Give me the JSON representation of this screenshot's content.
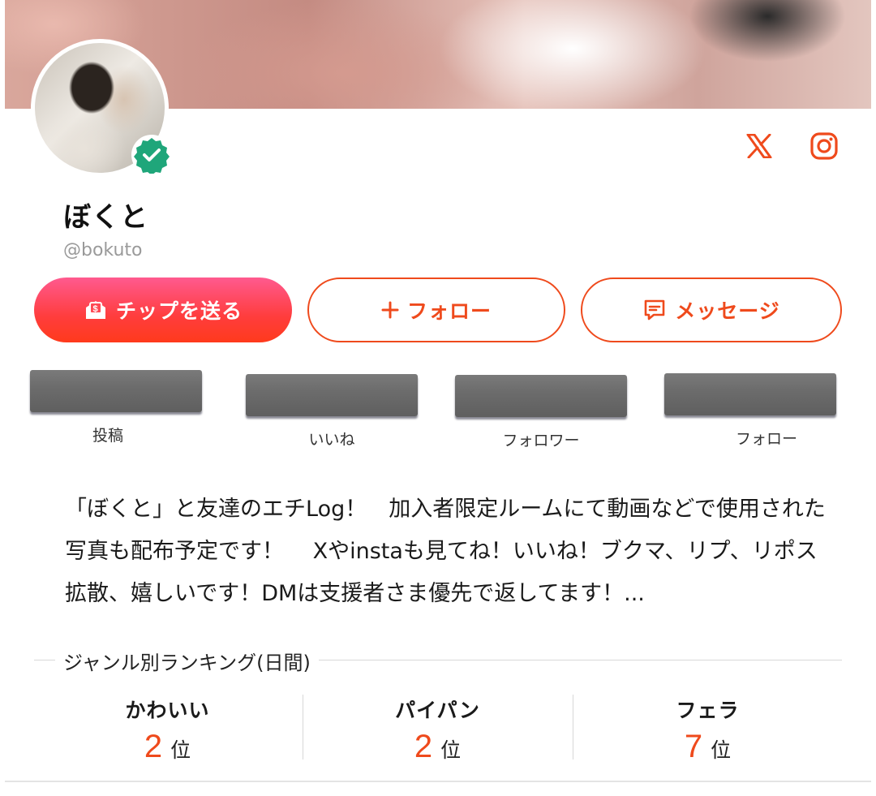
{
  "profile": {
    "name": "ぼくと",
    "handle": "@bokuto",
    "verified": true
  },
  "social": {
    "x_icon": "x-logo",
    "instagram_icon": "instagram-logo"
  },
  "actions": {
    "tip_label": "チップを送る",
    "follow_label": "フォロー",
    "message_label": "メッセージ"
  },
  "stats": [
    {
      "label": "投稿"
    },
    {
      "label": "いいね"
    },
    {
      "label": "フォロワー"
    },
    {
      "label": "フォロー"
    }
  ],
  "bio": "「ぼくと」と友達のエチLog！　加入者限定ルームにて動画などで使用された写真も配布予定です！　 Xやinstaも見てね！いいね！ブクマ、リプ、リポス拡散、嬉しいです！DMは支援者さま優先で返してます！...",
  "ranking": {
    "title": "ジャンル別ランキング(日間)",
    "unit": "位",
    "items": [
      {
        "genre": "かわいい",
        "rank": "2"
      },
      {
        "genre": "パイパン",
        "rank": "2"
      },
      {
        "genre": "フェラ",
        "rank": "7"
      }
    ]
  },
  "colors": {
    "accent": "#ef4a1c",
    "tip_gradient_start": "#ff5a8f",
    "tip_gradient_end": "#ff3a1c",
    "verified": "#1fa67a"
  }
}
